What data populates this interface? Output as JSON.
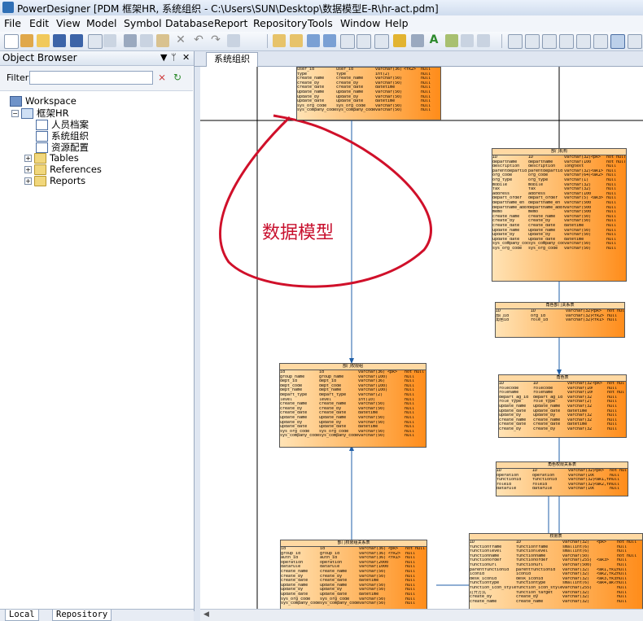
{
  "window": {
    "title": "PowerDesigner [PDM 框架HR, 系统组织 - C:\\Users\\SUN\\Desktop\\数据模型E-R\\hr-act.pdm]"
  },
  "menu": [
    "File",
    "Edit",
    "View",
    "Model",
    "Symbol",
    "Database",
    "Report",
    "Repository",
    "Tools",
    "Window",
    "Help"
  ],
  "object_browser": {
    "title": "Object Browser",
    "pin": "▼ ₱ ✕",
    "filter_label": "Filter:",
    "filter_value": "",
    "tree": [
      {
        "label": "Workspace",
        "icon": "workspace-icon"
      },
      {
        "label": "框架HR",
        "icon": "model-icon"
      },
      {
        "label": "人员档案",
        "icon": "diagram-icon"
      },
      {
        "label": "系统组织",
        "icon": "diagram-icon"
      },
      {
        "label": "资源配置",
        "icon": "diagram-icon"
      },
      {
        "label": "Tables",
        "icon": "folder-icon"
      },
      {
        "label": "References",
        "icon": "folder-icon"
      },
      {
        "label": "Reports",
        "icon": "folder-icon"
      }
    ],
    "bottom_tabs": [
      "Local",
      "Repository"
    ]
  },
  "document_tab": "系统组织",
  "annotation": "数据模型",
  "tables": [
    {
      "name": "",
      "rows": [
        [
          "user_id",
          "user_id",
          "varchar(36)",
          "<fk2>",
          "null"
        ],
        [
          "type",
          "type",
          "int(2)",
          "",
          "null"
        ],
        [
          "create_name",
          "create_name",
          "varchar(50)",
          "",
          "null"
        ],
        [
          "create_by",
          "create_by",
          "varchar(50)",
          "",
          "null"
        ],
        [
          "create_date",
          "create_date",
          "datetime",
          "",
          "null"
        ],
        [
          "update_name",
          "update_name",
          "varchar(50)",
          "",
          "null"
        ],
        [
          "update_by",
          "update_by",
          "varchar(50)",
          "",
          "null"
        ],
        [
          "update_date",
          "update_date",
          "datetime",
          "",
          "null"
        ],
        [
          "sys_org_code",
          "sys_org_code",
          "varchar(50)",
          "",
          "null"
        ],
        [
          "sys_company_code",
          "sys_company_code",
          "varchar(50)",
          "",
          "null"
        ]
      ]
    },
    {
      "name": "部门机构",
      "rows": [
        [
          "ID",
          "ID",
          "varchar(32)",
          "<pk>",
          "not null"
        ],
        [
          "departname",
          "departname",
          "varchar(100)",
          "",
          "not null"
        ],
        [
          "description",
          "description",
          "longtext",
          "",
          "null"
        ],
        [
          "parentdepartid",
          "parentdepartid",
          "varchar(32)",
          "<ak1>",
          "null"
        ],
        [
          "org_code",
          "org_code",
          "varchar(64)",
          "<ak2>",
          "null"
        ],
        [
          "org_type",
          "org_type",
          "varchar(1)",
          "",
          "null"
        ],
        [
          "mobile",
          "mobile",
          "varchar(32)",
          "",
          "null"
        ],
        [
          "fax",
          "fax",
          "varchar(32)",
          "",
          "null"
        ],
        [
          "address",
          "address",
          "varchar(100)",
          "",
          "null"
        ],
        [
          "depart_order",
          "depart_order",
          "varchar(5)",
          "<ak3>",
          "null"
        ],
        [
          "departname_en",
          "departname_en",
          "varchar(500)",
          "",
          "null"
        ],
        [
          "departname_abbr",
          "departname_abbr",
          "varchar(500)",
          "",
          "null"
        ],
        [
          "memo",
          "memo",
          "varchar(500)",
          "",
          "null"
        ],
        [
          "create_name",
          "create_name",
          "varchar(50)",
          "",
          "null"
        ],
        [
          "create_by",
          "create_by",
          "varchar(50)",
          "",
          "null"
        ],
        [
          "create_date",
          "create_date",
          "datetime",
          "",
          "null"
        ],
        [
          "update_name",
          "update_name",
          "varchar(50)",
          "",
          "null"
        ],
        [
          "update_by",
          "update_by",
          "varchar(50)",
          "",
          "null"
        ],
        [
          "update_date",
          "update_date",
          "datetime",
          "",
          "null"
        ],
        [
          "sys_company_code",
          "sys_company_code",
          "varchar(50)",
          "",
          "null"
        ],
        [
          "sys_org_code",
          "sys_org_code",
          "varchar(50)",
          "",
          "null"
        ]
      ]
    },
    {
      "name": "角色部门关系表",
      "rows": [
        [
          "ID",
          "ID",
          "varchar(32)",
          "<pk>",
          "not null"
        ],
        [
          "部门id",
          "org_id",
          "varchar(32)",
          "<fk2>",
          "null"
        ],
        [
          "角色id",
          "role_id",
          "varchar(32)",
          "<fk1>",
          "null"
        ]
      ]
    },
    {
      "name": "部门权限组",
      "rows": [
        [
          "id",
          "id",
          "varchar(36)",
          "<pk>",
          "not null"
        ],
        [
          "group_name",
          "group_name",
          "varchar(100)",
          "",
          "null"
        ],
        [
          "dept_id",
          "dept_id",
          "varchar(36)",
          "",
          "null"
        ],
        [
          "dept_code",
          "dept_code",
          "varchar(100)",
          "",
          "null"
        ],
        [
          "dept_name",
          "dept_name",
          "varchar(100)",
          "",
          "null"
        ],
        [
          "depart_type",
          "depart_type",
          "varchar(2)",
          "",
          "null"
        ],
        [
          "level",
          "level",
          "int(10)",
          "",
          "null"
        ],
        [
          "create_name",
          "create_name",
          "varchar(50)",
          "",
          "null"
        ],
        [
          "create_by",
          "create_by",
          "varchar(50)",
          "",
          "null"
        ],
        [
          "create_date",
          "create_date",
          "datetime",
          "",
          "null"
        ],
        [
          "update_name",
          "update_name",
          "varchar(50)",
          "",
          "null"
        ],
        [
          "update_by",
          "update_by",
          "varchar(50)",
          "",
          "null"
        ],
        [
          "update_date",
          "update_date",
          "datetime",
          "",
          "null"
        ],
        [
          "sys_org_code",
          "sys_org_code",
          "varchar(50)",
          "",
          "null"
        ],
        [
          "sys_company_code",
          "sys_company_code",
          "varchar(50)",
          "",
          "null"
        ]
      ]
    },
    {
      "name": "角色表",
      "rows": [
        [
          "ID",
          "ID",
          "varchar(32)",
          "<pk>",
          "not null"
        ],
        [
          "rolecode",
          "rolecode",
          "varchar(100)",
          "",
          "null"
        ],
        [
          "rolename",
          "rolename",
          "varchar(100)",
          "",
          "not null"
        ],
        [
          "depart_ag_id",
          "depart_ag_id",
          "varchar(32)",
          "",
          "null"
        ],
        [
          "role_type",
          "role_type",
          "varchar(2)",
          "",
          "null"
        ],
        [
          "update_name",
          "update_name",
          "varchar(32)",
          "",
          "null"
        ],
        [
          "update_date",
          "update_date",
          "datetime",
          "",
          "null"
        ],
        [
          "update_by",
          "update_by",
          "varchar(32)",
          "",
          "null"
        ],
        [
          "create_name",
          "create_name",
          "varchar(32)",
          "",
          "null"
        ],
        [
          "create_date",
          "create_date",
          "datetime",
          "",
          "null"
        ],
        [
          "create_by",
          "create_by",
          "varchar(32)",
          "",
          "null"
        ]
      ]
    },
    {
      "name": "角色权限关系表",
      "rows": [
        [
          "ID",
          "ID",
          "varchar(32)",
          "<pk>",
          "not null"
        ],
        [
          "operation",
          "operation",
          "varchar(1000)",
          "",
          "null"
        ],
        [
          "functionid",
          "functionid",
          "varchar(32)",
          "<ak1,fk2>",
          "null"
        ],
        [
          "roleid",
          "roleid",
          "varchar(32)",
          "<ak2,fk1>",
          "null"
        ],
        [
          "datarule",
          "datarule",
          "varchar(1000)",
          "",
          "null"
        ]
      ]
    },
    {
      "name": "部门权限组关系表",
      "rows": [
        [
          "id",
          "id",
          "varchar(36)",
          "<pk>",
          "not null"
        ],
        [
          "group_id",
          "group_id",
          "varchar(36)",
          "<fk2>",
          "null"
        ],
        [
          "auth_id",
          "auth_id",
          "varchar(36)",
          "<fk1>",
          "null"
        ],
        [
          "operation",
          "operation",
          "varchar(2000)",
          "",
          "null"
        ],
        [
          "datarule",
          "datarule",
          "varchar(1000)",
          "",
          "null"
        ],
        [
          "create_name",
          "create_name",
          "varchar(50)",
          "",
          "null"
        ],
        [
          "create_by",
          "create_by",
          "varchar(50)",
          "",
          "null"
        ],
        [
          "create_date",
          "create_date",
          "datetime",
          "",
          "null"
        ],
        [
          "update_name",
          "update_name",
          "varchar(50)",
          "",
          "null"
        ],
        [
          "update_by",
          "update_by",
          "varchar(50)",
          "",
          "null"
        ],
        [
          "update_date",
          "update_date",
          "datetime",
          "",
          "null"
        ],
        [
          "sys_org_code",
          "sys_org_code",
          "varchar(50)",
          "",
          "null"
        ],
        [
          "sys_company_code",
          "sys_company_code",
          "varchar(50)",
          "",
          "null"
        ]
      ]
    },
    {
      "name": "权限表",
      "rows": [
        [
          "ID",
          "ID",
          "varchar(32)",
          "<pk>",
          "not null"
        ],
        [
          "functionframe",
          "functionframe",
          "smallint(6)",
          "",
          "null"
        ],
        [
          "functionlevel",
          "functionlevel",
          "smallint(6)",
          "",
          "null"
        ],
        [
          "functionname",
          "functionname",
          "varchar(50)",
          "",
          "not null"
        ],
        [
          "functionorder",
          "functionorder",
          "varchar(255)",
          "<ak3>",
          "null"
        ],
        [
          "functionurl",
          "functionurl",
          "varchar(500)",
          "",
          "null"
        ],
        [
          "parentfunctionid",
          "parentfunctionid",
          "varchar(32)",
          "<ak1,fk1>",
          "null"
        ],
        [
          "iconid",
          "iconid",
          "varchar(32)",
          "<ak2,fk2>",
          "null"
        ],
        [
          "desk_iconid",
          "desk_iconid",
          "varchar(32)",
          "<ak3,fk3>",
          "null"
        ],
        [
          "functiontype",
          "functiontype",
          "smallint(6)",
          "<ak4,ak7>",
          "null"
        ],
        [
          "function_icon_style",
          "function_icon_style",
          "varchar(255)",
          "",
          "null"
        ],
        [
          "打开方式",
          "function_target",
          "varchar(32)",
          "",
          "null"
        ],
        [
          "create_by",
          "create_by",
          "varchar(32)",
          "",
          "null"
        ],
        [
          "create_name",
          "create_name",
          "varchar(32)",
          "",
          "null"
        ]
      ]
    }
  ]
}
